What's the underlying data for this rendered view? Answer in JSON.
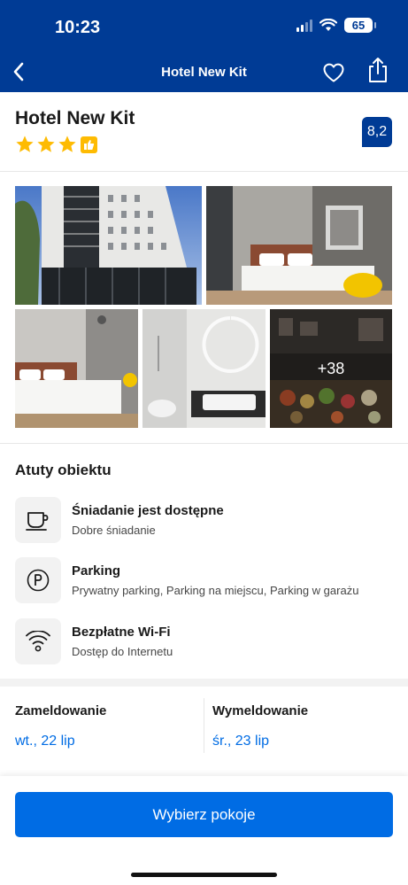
{
  "status": {
    "time": "10:23",
    "battery": "65"
  },
  "nav": {
    "title": "Hotel New Kit"
  },
  "hotel": {
    "name": "Hotel New Kit",
    "stars": 3,
    "score": "8,2"
  },
  "gallery": {
    "more_count": "+38"
  },
  "features": {
    "title": "Atuty obiektu",
    "items": [
      {
        "icon": "coffee-cup-icon",
        "title": "Śniadanie jest dostępne",
        "subtitle": "Dobre śniadanie"
      },
      {
        "icon": "parking-icon",
        "title": "Parking",
        "subtitle": "Prywatny parking, Parking na miejscu, Parking w garażu"
      },
      {
        "icon": "wifi-icon",
        "title": "Bezpłatne Wi-Fi",
        "subtitle": "Dostęp do Internetu"
      }
    ]
  },
  "checkin": {
    "label": "Zameldowanie",
    "date": "wt., 22 lip"
  },
  "checkout": {
    "label": "Wymeldowanie",
    "date": "śr., 23 lip"
  },
  "cta": {
    "label": "Wybierz pokoje"
  },
  "colors": {
    "brand": "#003b95",
    "action": "#006ce4",
    "star": "#febb02"
  }
}
